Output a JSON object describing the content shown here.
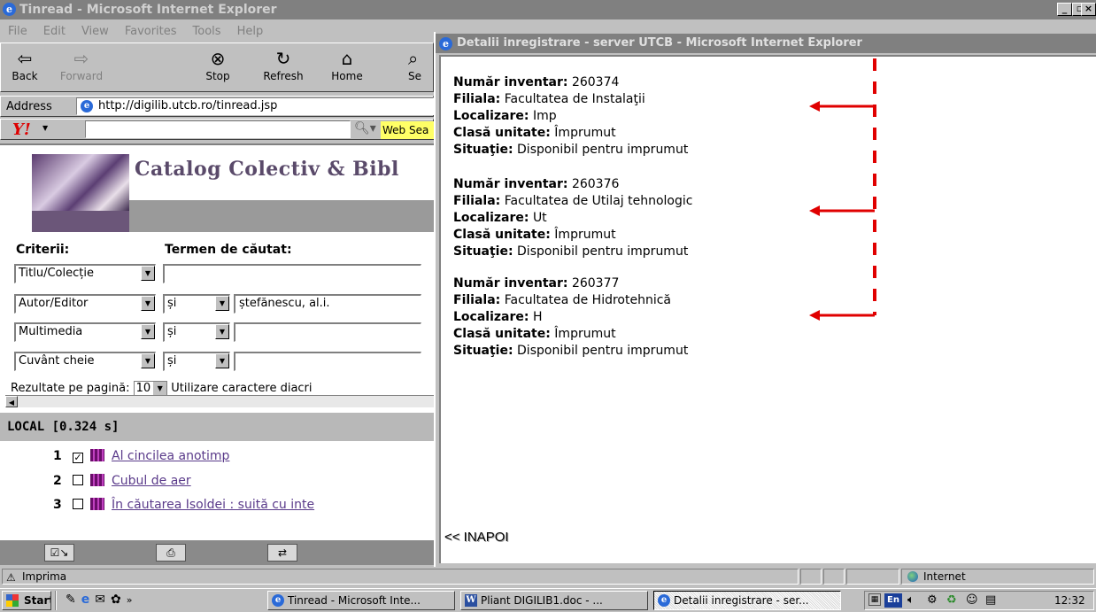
{
  "main_window": {
    "title": "Tinread - Microsoft Internet Explorer",
    "controls": [
      "_",
      "×"
    ]
  },
  "menu": [
    "File",
    "Edit",
    "View",
    "Favorites",
    "Tools",
    "Help"
  ],
  "toolbar": {
    "buttons": [
      {
        "label": "Back",
        "icon": "back-arrow-icon",
        "glyph": "⇦"
      },
      {
        "label": "Forward",
        "icon": "forward-arrow-icon",
        "glyph": "⇨"
      },
      {
        "label": "Stop",
        "icon": "stop-icon",
        "glyph": "⊗"
      },
      {
        "label": "Refresh",
        "icon": "refresh-icon",
        "glyph": "↻"
      },
      {
        "label": "Home",
        "icon": "home-icon",
        "glyph": "⌂"
      },
      {
        "label": "Se",
        "icon": "search-icon",
        "glyph": "⌕"
      }
    ]
  },
  "address": {
    "label": "Address",
    "url": "http://digilib.utcb.ro/tinread.jsp"
  },
  "yahoo": {
    "logo": "Y!",
    "web_search_label": "Web Sea"
  },
  "page": {
    "catalog_title": "Catalog Colectiv & Bibl",
    "criterii_label": "Criterii:",
    "termen_label": "Termen de căutat:",
    "rows": [
      {
        "field": "Titlu/Colecție",
        "op": "",
        "term": ""
      },
      {
        "field": "Autor/Editor",
        "op": "și",
        "term": "ștefănescu, al.i."
      },
      {
        "field": "Multimedia",
        "op": "și",
        "term": ""
      },
      {
        "field": "Cuvânt cheie",
        "op": "și",
        "term": ""
      }
    ],
    "results_per_page_label": "Rezultate pe pagină:",
    "results_per_page_value": "10",
    "diacritics_label": "Utilizare caractere diacri",
    "local_label": "LOCAL [0.324 s]",
    "results": [
      {
        "num": "1",
        "checked": "☑",
        "title": "Al cincilea anotimp"
      },
      {
        "num": "2",
        "checked": "☐",
        "title": "Cubul de aer"
      },
      {
        "num": "3",
        "checked": "☐",
        "title": "În căutarea Isoldei : suită cu inte"
      }
    ]
  },
  "popup": {
    "title": "Detalii inregistrare - server UTCB - Microsoft Internet Explorer",
    "records": [
      {
        "inventar_label": "Număr inventar:",
        "inventar": "260374",
        "filiala_label": "Filiala:",
        "filiala": "Facultatea de Instalaţii",
        "localizare_label": "Localizare:",
        "localizare": "Imp",
        "clasa_label": "Clasă unitate:",
        "clasa": "Împrumut",
        "situatie_label": "Situaţie:",
        "situatie": "Disponibil pentru imprumut"
      },
      {
        "inventar_label": "Număr inventar:",
        "inventar": "260376",
        "filiala_label": "Filiala:",
        "filiala": "Facultatea de Utilaj tehnologic",
        "localizare_label": "Localizare:",
        "localizare": "Ut",
        "clasa_label": "Clasă unitate:",
        "clasa": "Împrumut",
        "situatie_label": "Situaţie:",
        "situatie": "Disponibil pentru imprumut"
      },
      {
        "inventar_label": "Număr inventar:",
        "inventar": "260377",
        "filiala_label": "Filiala:",
        "filiala": "Facultatea de Hidrotehnică",
        "localizare_label": "Localizare:",
        "localizare": "H",
        "clasa_label": "Clasă unitate:",
        "clasa": "Împrumut",
        "situatie_label": "Situaţie:",
        "situatie": "Disponibil pentru imprumut"
      }
    ],
    "back_link": "<< INAPOI",
    "annotation_color": "#e00000"
  },
  "status": {
    "text": "Imprima",
    "zone": "Internet"
  },
  "taskbar": {
    "start": "Start",
    "tasks": [
      {
        "label": "Tinread - Microsoft Inte...",
        "active": false
      },
      {
        "label": "Pliant DIGILIB1.doc - ...",
        "active": false
      },
      {
        "label": "Detalii inregistrare - ser...",
        "active": true
      }
    ],
    "clock": "12:32",
    "lang": "En"
  }
}
